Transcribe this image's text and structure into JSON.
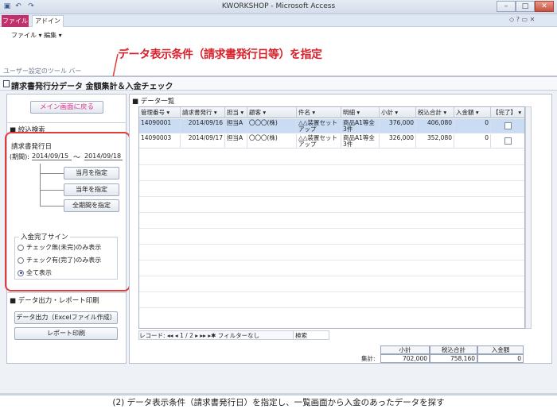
{
  "window": {
    "title": "KWORKSHOP - Microsoft Access",
    "min": "–",
    "max": "□",
    "close": "✕",
    "ribbon_min": "◇ ? ▭ ✕"
  },
  "ribbon": {
    "tab_file": "ファイル",
    "tab_addin": "アドイン",
    "menu_file": "ファイル ▾",
    "menu_edit": "編集 ▾",
    "toolbar_label": "ユーザー設定のツール バー"
  },
  "annotation": "データ表示条件（請求書発行日等）を指定",
  "form": {
    "title": "請求書発行分データ 金額集計＆入金チェック",
    "back_button": "メイン画面に戻る",
    "filter_section": "■ 絞込検索",
    "date_label": "請求書発行日",
    "period_label": "(期間):",
    "date_from": "2014/09/15",
    "tilde": "～",
    "date_to": "2014/09/18",
    "btn_month": "当月を指定",
    "btn_year": "当年を指定",
    "btn_all": "全期間を指定",
    "paid_label": "入金完了サイン",
    "radio_unpaid": "チェック無(未完)のみ表示",
    "radio_paid": "チェック有(完了)のみ表示",
    "radio_all": "全て表示",
    "output_section": "■ データ出力・レポート印刷",
    "btn_export": "データ出力（Excelファイル作成）",
    "btn_report": "レポート印刷"
  },
  "grid": {
    "section": "■ データ一覧",
    "headers": [
      "管理番号 ▾",
      "請求書発行 ▾",
      "担当 ▾",
      "顧客 ▾",
      "件名 ▾",
      "明細 ▾",
      "小計 ▾",
      "税込合計 ▾",
      "入金額 ▾",
      "【完了】 ▾"
    ],
    "rows": [
      {
        "id": "14090001",
        "date": "2014/09/16",
        "staff": "担当A",
        "customer": "〇〇〇(株)",
        "subject": "△△装置セットアップ",
        "detail": "商品A1等全3件",
        "subtotal": "376,000",
        "total": "406,080",
        "paid": "0"
      },
      {
        "id": "14090003",
        "date": "2014/09/17",
        "staff": "担当A",
        "customer": "〇〇〇(株)",
        "subject": "△△装置セットアップ",
        "detail": "商品A1等全3件",
        "subtotal": "326,000",
        "total": "352,080",
        "paid": "0"
      }
    ]
  },
  "nav": {
    "record_label": "レコード:",
    "first": "◂◂",
    "prev": "◂",
    "position": "1 / 2",
    "next": "▸",
    "last": "▸▸",
    "new": "▸✱",
    "filter": "フィルターなし",
    "search": "検索"
  },
  "totals": {
    "label": "集計:",
    "h_subtotal": "小計",
    "h_total": "税込合計",
    "h_paid": "入金額",
    "subtotal": "702,000",
    "total": "758,160",
    "paid": "0"
  },
  "caption": "(2) データ表示条件（請求書発行日）を指定し、一覧画面から入金のあったデータを探す"
}
